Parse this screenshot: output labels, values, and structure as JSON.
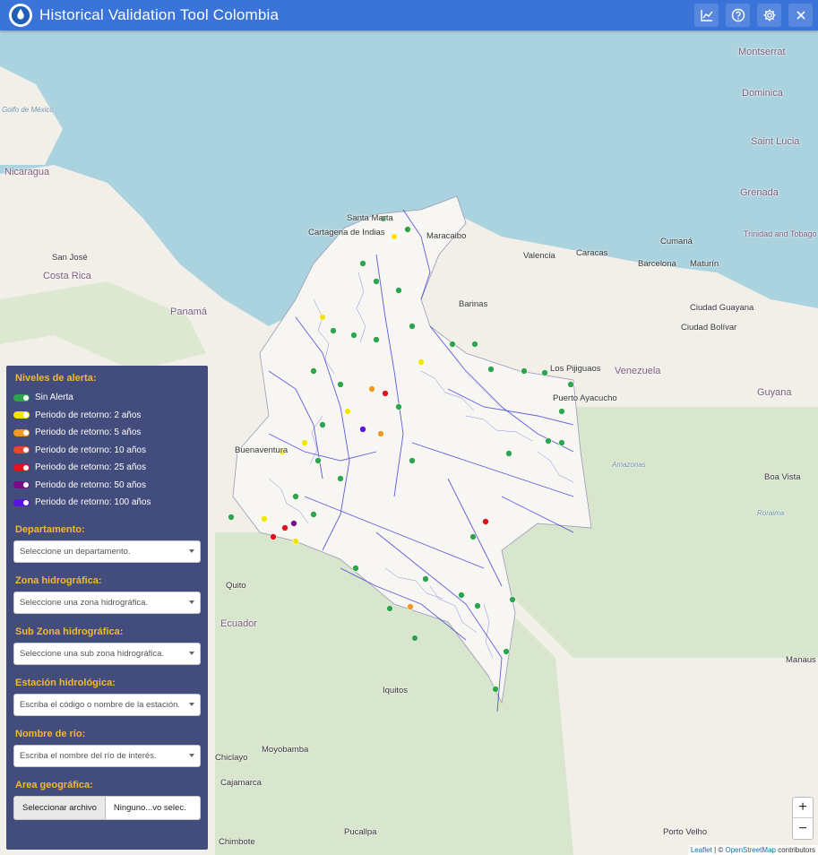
{
  "header": {
    "title": "Historical Validation Tool Colombia",
    "buttons": [
      {
        "name": "chart-button",
        "icon": "line-chart-icon"
      },
      {
        "name": "help-button",
        "icon": "question-icon"
      },
      {
        "name": "settings-button",
        "icon": "gear-icon"
      },
      {
        "name": "close-button",
        "icon": "close-icon"
      }
    ]
  },
  "legend": {
    "title": "Niveles de alerta:",
    "items": [
      {
        "label": "Sin Alerta",
        "color": "#2ea44f"
      },
      {
        "label": "Periodo de retorno: 2 años",
        "color": "#f2e600"
      },
      {
        "label": "Periodo de retorno: 5 años",
        "color": "#f09a22"
      },
      {
        "label": "Periodo de retorno: 10 años",
        "color": "#f0442a"
      },
      {
        "label": "Periodo de retorno: 25 años",
        "color": "#e0121a"
      },
      {
        "label": "Periodo de retorno: 50 años",
        "color": "#7a0a8a"
      },
      {
        "label": "Periodo de retorno: 100 años",
        "color": "#5a14e0"
      }
    ]
  },
  "filters": {
    "departamento": {
      "label": "Departamento:",
      "placeholder": "Seleccione un departamento."
    },
    "zona": {
      "label": "Zona hidrográfica:",
      "placeholder": "Seleccione una zona hidrográfica."
    },
    "subzona": {
      "label": "Sub Zona hidrográfica:",
      "placeholder": "Seleccione una sub zona hidrográfica."
    },
    "estacion": {
      "label": "Estación hidrológica:",
      "placeholder": "Escriba el código o nombre de la estación."
    },
    "rio": {
      "label": "Nombre de río:",
      "placeholder": "Escriba el nombre del río de interés."
    },
    "area": {
      "label": "Area geográfica:",
      "button": "Seleccionar archivo",
      "file": "Ninguno...vo selec."
    }
  },
  "map": {
    "places": [
      {
        "t": "Golfo de México",
        "k": "sea"
      },
      {
        "t": "Nicaragua",
        "k": "country"
      },
      {
        "t": "Costa Rica",
        "k": "country"
      },
      {
        "t": "Panamá",
        "k": "country"
      },
      {
        "t": "San José",
        "k": "city"
      },
      {
        "t": "Cartagena de Indias",
        "k": "city"
      },
      {
        "t": "Santa Marta",
        "k": "city"
      },
      {
        "t": "Maracaibo",
        "k": "city"
      },
      {
        "t": "Caracas",
        "k": "city"
      },
      {
        "t": "Barcelona",
        "k": "city"
      },
      {
        "t": "Maturín",
        "k": "city"
      },
      {
        "t": "Cumaná",
        "k": "city"
      },
      {
        "t": "Trinidad and Tobago",
        "k": "country"
      },
      {
        "t": "Venezuela",
        "k": "country"
      },
      {
        "t": "Ciudad Guayana",
        "k": "city"
      },
      {
        "t": "Ciudad Bolívar",
        "k": "city"
      },
      {
        "t": "Barinas",
        "k": "city"
      },
      {
        "t": "Valencia",
        "k": "city"
      },
      {
        "t": "Los Pijiguaos",
        "k": "city"
      },
      {
        "t": "Puerto Ayacucho",
        "k": "city"
      },
      {
        "t": "Boa Vista",
        "k": "city"
      },
      {
        "t": "Manaus",
        "k": "city"
      },
      {
        "t": "Quito",
        "k": "city"
      },
      {
        "t": "Ecuador",
        "k": "country"
      },
      {
        "t": "Iquitos",
        "k": "city"
      },
      {
        "t": "Chiclayo",
        "k": "city"
      },
      {
        "t": "Cajamarca",
        "k": "city"
      },
      {
        "t": "Moyobamba",
        "k": "city"
      },
      {
        "t": "Chimbote",
        "k": "city"
      },
      {
        "t": "Pucallpa",
        "k": "city"
      },
      {
        "t": "Porto Velho",
        "k": "city"
      },
      {
        "t": "Buenaventura",
        "k": "city"
      },
      {
        "t": "Guyana",
        "k": "country"
      },
      {
        "t": "Saint Lucia",
        "k": "country"
      },
      {
        "t": "Grenada",
        "k": "country"
      },
      {
        "t": "Dominica",
        "k": "country"
      },
      {
        "t": "Montserrat",
        "k": "country"
      },
      {
        "t": "Amazonas",
        "k": "sea"
      },
      {
        "t": "Roraima",
        "k": "sea"
      }
    ]
  },
  "zoom": {
    "in": "+",
    "out": "−"
  },
  "attribution": {
    "leaflet": "Leaflet",
    "sep": " | © ",
    "osm": "OpenStreetMap",
    "rest": " contributors"
  }
}
